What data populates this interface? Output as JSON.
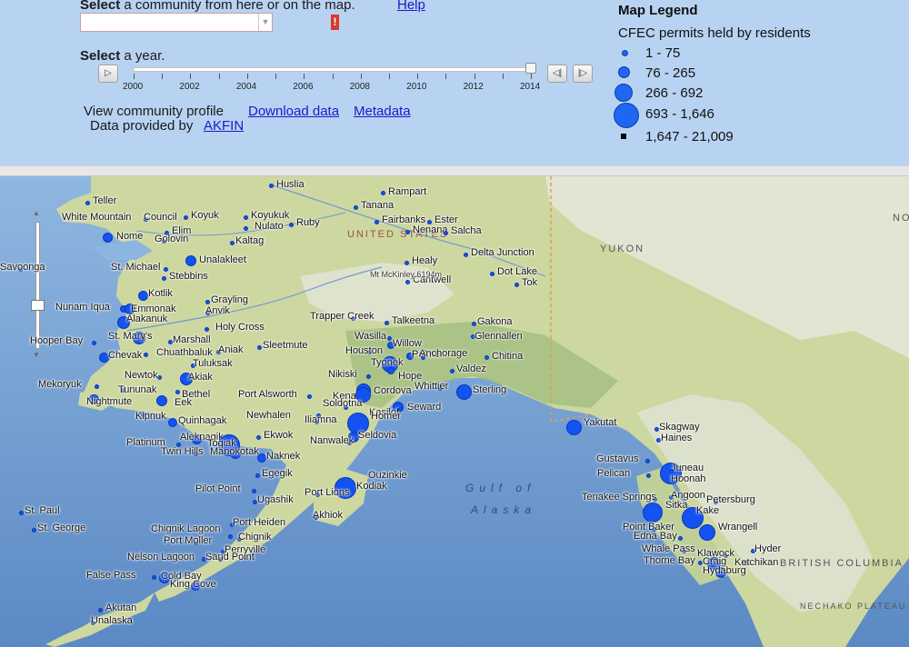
{
  "controls": {
    "select_prefix": "Select",
    "select_community_rest": " a community from here or on the map.",
    "help_link": "Help",
    "required_marker": "!",
    "select_year_prefix": "Select",
    "select_year_rest": " a year.",
    "years": [
      "2000",
      "2002",
      "2004",
      "2006",
      "2008",
      "2010",
      "2012",
      "2014"
    ],
    "selected_year": "2014",
    "view_profile": "View community profile",
    "download_link": "Download data",
    "metadata_link": "Metadata",
    "data_provided": "Data provided by",
    "akfin_link": "AKFIN"
  },
  "legend": {
    "title": "Map Legend",
    "subtitle": "CFEC permits held by residents",
    "classes": [
      {
        "label": "1 - 75"
      },
      {
        "label": "76 - 265"
      },
      {
        "label": "266 - 692"
      },
      {
        "label": "693 - 1,646"
      },
      {
        "label": "1,647 - 21,009"
      }
    ],
    "symbol_color": "#1f66f0"
  },
  "map": {
    "regions": [
      "UNITED STATES",
      "YUKON",
      "BRITISH COLUMBIA",
      "NECHAKO PLATEAU",
      "NO"
    ],
    "sea_label_1": "Gulf of",
    "sea_label_2": "Alaska",
    "colors": {
      "land": "#cfd9a4",
      "ocean": "#6f9bd0",
      "mountains": "#e9ece4",
      "forest": "#8fb075"
    },
    "places": [
      "Huslia",
      "Rampart",
      "Tanana",
      "Teller",
      "Koyuk",
      "Koyukuk",
      "Fairbanks",
      "Ester",
      "White Mountain",
      "Council",
      "Nulato",
      "Ruby",
      "Nenana",
      "Salcha",
      "Elim",
      "Nome",
      "Golovin",
      "Kaltag",
      "Delta Junction",
      "Unalakleet",
      "Healy",
      "Dot Lake",
      "Savoonga",
      "St. Michael",
      "Stebbins",
      "Cantwell",
      "Tok",
      "Kotlik",
      "Grayling",
      "Nunam Iqua",
      "Emmonak",
      "Anvik",
      "Alakanuk",
      "Trapper Creek",
      "Gakona",
      "Talkeetna",
      "Glennallen",
      "Holy Cross",
      "Hooper Bay",
      "St. Mary's",
      "Marshall",
      "Wasilla",
      "Willow",
      "Chevak",
      "Chuathbaluk",
      "Aniak",
      "Sleetmute",
      "Houston",
      "Palmer",
      "Chitina",
      "Tuluksak",
      "Tyonek",
      "Anchorage",
      "Valdez",
      "Mekoryuk",
      "Newtok",
      "Akiak",
      "Nikiski",
      "Hope",
      "Whittier",
      "Tununak",
      "Bethel",
      "Sterling",
      "Kenai",
      "Cordova",
      "Port Alsworth",
      "Nightmute",
      "Eek",
      "Soldotna",
      "Kasilof",
      "Seward",
      "Kipnuk",
      "Newhalen",
      "Iliamna",
      "Quinhagak",
      "Homer",
      "Aleknagik",
      "Seldovia",
      "Platinum",
      "Ekwok",
      "Togiak",
      "Nanwalek",
      "Twin Hills",
      "Manokotak",
      "Naknek",
      "Egegik",
      "Ouzinkie",
      "Pilot Point",
      "Kodiak",
      "Ugashik",
      "Port Lions",
      "St. Paul",
      "Akhiok",
      "Port Heiden",
      "St. George",
      "Chignik Lagoon",
      "Port Moller",
      "Chignik",
      "Perryville",
      "Nelson Lagoon",
      "Sand Point",
      "False Pass",
      "Cold Bay",
      "King Cove",
      "Akutan",
      "Unalaska",
      "Yakutat",
      "Skagway",
      "Haines",
      "Gustavus",
      "Juneau",
      "Pelican",
      "Hoonah",
      "Angoon",
      "Tenakee Springs",
      "Sitka",
      "Petersburg",
      "Kake",
      "Point Baker",
      "Wrangell",
      "Edna Bay",
      "Whale Pass",
      "Klawock",
      "Hyder",
      "Thorne Bay",
      "Craig",
      "Ketchikan",
      "Hydaburg",
      "Mt McKinley 6194m"
    ]
  }
}
